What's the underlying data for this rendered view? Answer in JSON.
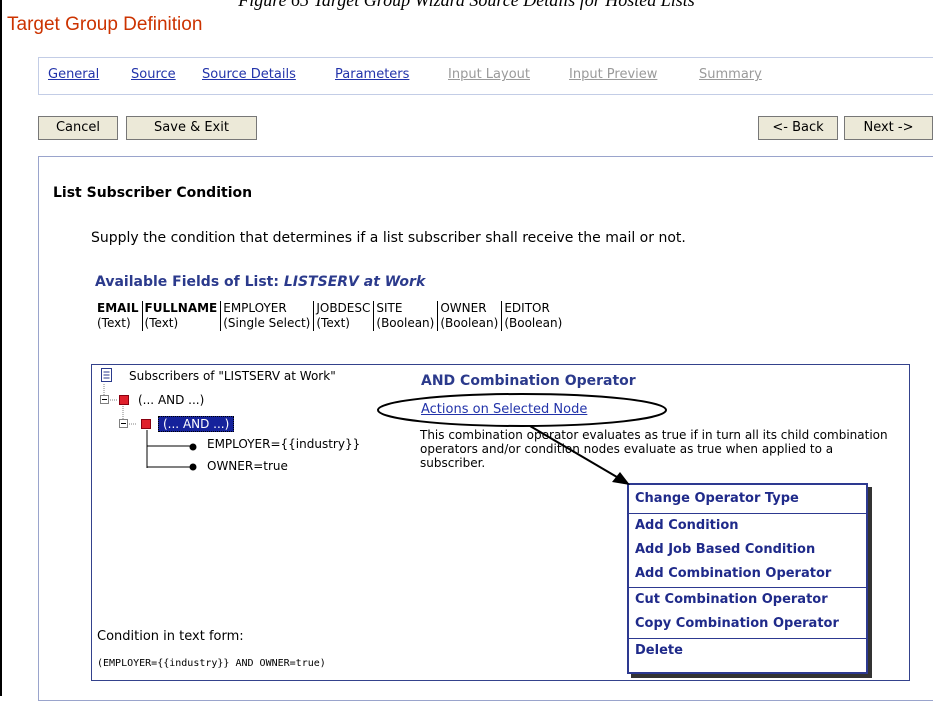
{
  "caption": "Figure 65 Target Group Wizard Source Details for Hosted Lists",
  "page_title": "Target Group Definition",
  "tabs": [
    {
      "label": "General",
      "state": "link"
    },
    {
      "label": "Source",
      "state": "link"
    },
    {
      "label": "Source Details",
      "state": "active"
    },
    {
      "label": "Parameters",
      "state": "link"
    },
    {
      "label": "Input Layout",
      "state": "disabled"
    },
    {
      "label": "Input Preview",
      "state": "disabled"
    },
    {
      "label": "Summary",
      "state": "disabled"
    }
  ],
  "buttons": {
    "cancel": "Cancel",
    "save_exit": "Save & Exit",
    "back": "<- Back",
    "next": "Next ->"
  },
  "section": {
    "heading": "List Subscriber Condition",
    "instructions": "Supply the condition that determines if a list subscriber shall receive the mail or not."
  },
  "fields": {
    "heading_prefix": "Available Fields of List: ",
    "list_name": "LISTSERV at Work",
    "columns": [
      {
        "name": "EMAIL",
        "type": "(Text)"
      },
      {
        "name": "FULLNAME",
        "type": "(Text)"
      },
      {
        "name": "EMPLOYER",
        "type": "(Single Select)"
      },
      {
        "name": "JOBDESC",
        "type": "(Text)"
      },
      {
        "name": "SITE",
        "type": "(Boolean)"
      },
      {
        "name": "OWNER",
        "type": "(Boolean)"
      },
      {
        "name": "EDITOR",
        "type": "(Boolean)"
      }
    ]
  },
  "tree": {
    "root": "Subscribers of \"LISTSERV at Work\"",
    "nodes": [
      "(... AND ...)",
      "(... AND ...)",
      "EMPLOYER={{industry}}",
      "OWNER=true"
    ]
  },
  "operator": {
    "title": "AND Combination Operator",
    "actions_link": "Actions on Selected Node",
    "description": "This combination operator evaluates as true if in turn all its child combination operators and/or condition nodes evaluate as true when applied to a subscriber."
  },
  "context_menu": {
    "items": [
      "Change Operator Type",
      "Add Condition",
      "Add Job Based Condition",
      "Add Combination Operator",
      "Cut Combination Operator",
      "Copy Combination Operator",
      "Delete"
    ]
  },
  "condition": {
    "label": "Condition in text form:",
    "expression": "(EMPLOYER={{industry}} AND OWNER=true)"
  },
  "colors": {
    "title": "#cc3300",
    "link": "#2233aa",
    "heading": "#2b3a8c",
    "selection": "#15229b",
    "node": "#e0202c"
  },
  "icons": {
    "root": "document-list-icon",
    "operator": "red-square-icon",
    "condition": "bullet-icon",
    "expand": "collapse-minus-icon"
  }
}
